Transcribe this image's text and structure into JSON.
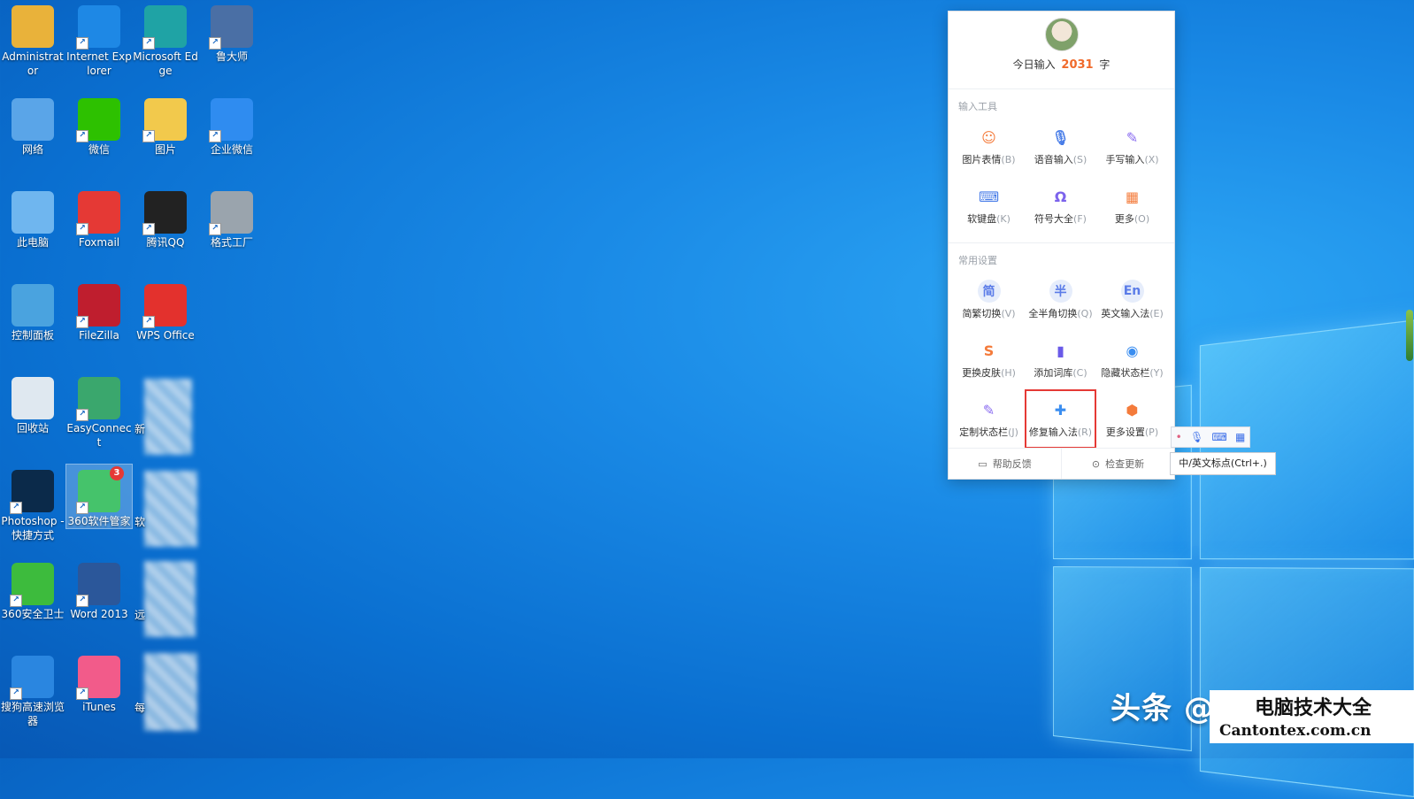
{
  "desktop": {
    "icons": [
      {
        "label": "Administrator",
        "icon": "user-folder-icon",
        "color": "#e9b23a"
      },
      {
        "label": "Internet Explorer",
        "icon": "ie-icon",
        "color": "#1e88e5"
      },
      {
        "label": "Microsoft Edge",
        "icon": "edge-icon",
        "color": "#1fa3a5"
      },
      {
        "label": "鲁大师",
        "icon": "ludashi-icon",
        "color": "#4a6fa5"
      },
      {
        "label": "网络",
        "icon": "network-icon",
        "color": "#5aa5e8"
      },
      {
        "label": "微信",
        "icon": "wechat-icon",
        "color": "#2dc100"
      },
      {
        "label": "图片",
        "icon": "folder-icon",
        "color": "#f2c94c"
      },
      {
        "label": "企业微信",
        "icon": "wecom-icon",
        "color": "#2f8cf0"
      },
      {
        "label": "此电脑",
        "icon": "computer-icon",
        "color": "#6fb6ef"
      },
      {
        "label": "Foxmail",
        "icon": "foxmail-icon",
        "color": "#e53935"
      },
      {
        "label": "腾讯QQ",
        "icon": "qq-icon",
        "color": "#222222"
      },
      {
        "label": "格式工厂",
        "icon": "format-factory-icon",
        "color": "#9aa4ad"
      },
      {
        "label": "控制面板",
        "icon": "control-panel-icon",
        "color": "#4aa3df"
      },
      {
        "label": "FileZilla",
        "icon": "filezilla-icon",
        "color": "#bf1e2e"
      },
      {
        "label": "WPS Office",
        "icon": "wps-icon",
        "color": "#e3312d"
      },
      {
        "label": "回收站",
        "icon": "recycle-bin-icon",
        "color": "#dfe8f0"
      },
      {
        "label": "EasyConnect",
        "icon": "easyconnect-icon",
        "color": "#3aa76d"
      },
      {
        "label": "Photoshop - 快捷方式",
        "icon": "photoshop-icon",
        "color": "#0b2a4a"
      },
      {
        "label": "360软件管家",
        "icon": "360-software-icon",
        "color": "#45c36b",
        "badge": "3"
      },
      {
        "label": "360安全卫士",
        "icon": "360-security-icon",
        "color": "#3dbb3d"
      },
      {
        "label": "Word 2013",
        "icon": "word-icon",
        "color": "#2b579a"
      },
      {
        "label": "搜狗高速浏览器",
        "icon": "sogou-browser-icon",
        "color": "#2a86e0"
      },
      {
        "label": "iTunes",
        "icon": "itunes-icon",
        "color": "#f25b8a"
      }
    ],
    "partial_labels": [
      "新",
      "软",
      "远",
      "每"
    ]
  },
  "ime_panel": {
    "today_prefix": "今日输入",
    "today_count": "2031",
    "today_suffix": "字",
    "tools_title": "输入工具",
    "tools": [
      {
        "label": "图片表情",
        "key": "(B)",
        "icon": "smile-icon",
        "glyph": "☺",
        "color": "#f47b3b"
      },
      {
        "label": "语音输入",
        "key": "(S)",
        "icon": "microphone-icon",
        "glyph": "🎙",
        "color": "#4a7ee8"
      },
      {
        "label": "手写输入",
        "key": "(X)",
        "icon": "pen-icon",
        "glyph": "✎",
        "color": "#8a6cf0"
      },
      {
        "label": "软键盘",
        "key": "(K)",
        "icon": "keyboard-icon",
        "glyph": "⌨",
        "color": "#4a7ee8"
      },
      {
        "label": "符号大全",
        "key": "(F)",
        "icon": "omega-icon",
        "glyph": "Ω",
        "color": "#7c63ec"
      },
      {
        "label": "更多",
        "key": "(O)",
        "icon": "apps-grid-icon",
        "glyph": "▦",
        "color": "#f47b3b"
      }
    ],
    "settings_title": "常用设置",
    "settings": [
      {
        "label": "简繁切换",
        "key": "(V)",
        "icon": "simplified-traditional-icon",
        "glyph": "简",
        "color": "#5b7ce8",
        "circle": true
      },
      {
        "label": "全半角切换",
        "key": "(Q)",
        "icon": "half-full-width-icon",
        "glyph": "半",
        "color": "#5b7ce8",
        "circle": true
      },
      {
        "label": "英文输入法",
        "key": "(E)",
        "icon": "english-icon",
        "glyph": "En",
        "color": "#5b7ce8",
        "circle": true
      },
      {
        "label": "更换皮肤",
        "key": "(H)",
        "icon": "skin-shirt-icon",
        "glyph": "S",
        "color": "#f47b3b"
      },
      {
        "label": "添加词库",
        "key": "(C)",
        "icon": "dictionary-icon",
        "glyph": "▮",
        "color": "#6a5ae8"
      },
      {
        "label": "隐藏状态栏",
        "key": "(Y)",
        "icon": "eye-hide-icon",
        "glyph": "◉",
        "color": "#3b8ef0"
      },
      {
        "label": "定制状态栏",
        "key": "(J)",
        "icon": "tools-icon",
        "glyph": "✎",
        "color": "#8a6cf0"
      },
      {
        "label": "修复输入法",
        "key": "(R)",
        "icon": "repair-kit-icon",
        "glyph": "✚",
        "color": "#3b8ef0",
        "highlight": true
      },
      {
        "label": "更多设置",
        "key": "(P)",
        "icon": "hexagon-settings-icon",
        "glyph": "⬢",
        "color": "#f47b3b"
      }
    ],
    "footer": {
      "feedback": "帮助反馈",
      "update": "检查更新"
    }
  },
  "status_tooltip": "中/英文标点(Ctrl+.)",
  "watermark": {
    "text": "头条 @相",
    "site_title": "电脑技术大全",
    "site_url": "Cantontex.com.cn"
  }
}
